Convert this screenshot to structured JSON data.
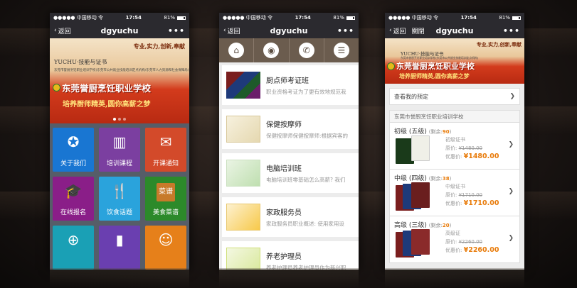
{
  "status_bar": {
    "carrier": "●●●●● 中国移动 令",
    "time": "17:54",
    "battery": "81%"
  },
  "phone1": {
    "nav": {
      "back": "返回",
      "title": "dgyuchu",
      "more": "•••"
    },
    "banner": {
      "slogan": "专业,实力,创新,奉献",
      "brand": "YUCHU·技能与证书",
      "brand_sub": "东莞市誉厨烹饪职业培训学校(东莞市公共就业技能培训定点机构/东莞市人力资源和社会保障局)",
      "school": "东莞誉厨烹饪职业学校",
      "tagline": "培养厨师精英,圆你高薪之梦"
    },
    "tiles": [
      {
        "label": "关于我们",
        "icon": "emblem-icon",
        "glyph": "✪"
      },
      {
        "label": "培训课程",
        "icon": "books-icon",
        "glyph": "▥"
      },
      {
        "label": "开课通知",
        "icon": "scroll-icon",
        "glyph": "✉"
      },
      {
        "label": "在线报名",
        "icon": "graduation-cap-icon",
        "glyph": "🎓"
      },
      {
        "label": "饮食话题",
        "icon": "utensils-icon",
        "glyph": "🍴"
      },
      {
        "label": "美食菜谱",
        "icon": "recipe-book-icon",
        "glyph": "菜谱"
      },
      {
        "label": "",
        "icon": "plus-icon",
        "glyph": "⊕"
      },
      {
        "label": "",
        "icon": "book-icon",
        "glyph": "▮"
      },
      {
        "label": "",
        "icon": "group-icon",
        "glyph": "☺"
      }
    ]
  },
  "phone2": {
    "nav": {
      "back": "返回",
      "title": "dgyuchu",
      "more": "•••"
    },
    "iconbar": [
      {
        "icon": "home-icon",
        "glyph": "⌂"
      },
      {
        "icon": "location-pin-icon",
        "glyph": "◉"
      },
      {
        "icon": "phone-icon",
        "glyph": "✆"
      },
      {
        "icon": "list-icon",
        "glyph": "☰"
      }
    ],
    "items": [
      {
        "title": "厨点师考证班",
        "desc": "职业资格考证为了更有效地规范我",
        "thumb": "th-books"
      },
      {
        "title": "保健按摩师",
        "desc": "保健按摩师保健按摩师:根据宾客的",
        "thumb": "th-massage"
      },
      {
        "title": "电脑培训班",
        "desc": "电脑培训班零基础怎么高薪? 我们",
        "thumb": "th-computer"
      },
      {
        "title": "家政服务员",
        "desc": "家政服务员职业概述: 使用家用设",
        "thumb": "th-family"
      },
      {
        "title": "养老护理员",
        "desc": "养老护理员养老护理员作为新兴职",
        "thumb": "th-elder"
      }
    ]
  },
  "phone3": {
    "nav": {
      "back": "返回",
      "close": "關閉",
      "title": "dgyuchu",
      "more": "•••"
    },
    "banner": {
      "slogan": "专业,实力,创新,奉献",
      "brand": "YUCHU·技能与证书",
      "brand_sub": "东莞市誉厨烹饪职业培训学校(东莞市公共就业技能培训定点机构)",
      "school": "东莞誉厨烹饪职业学校",
      "tagline": "培养厨师精英,圆你高薪之梦"
    },
    "reserve": "查看我的预定",
    "section": "东莞市誉厨烹饪职业培训学校",
    "courses": [
      {
        "level": "初级 (五级)",
        "remaining_label": "(剩余:",
        "remaining": "90",
        "cert": "初级证书",
        "orig": "¥1480.00",
        "price_label": "优惠价:",
        "price": "¥1480.00"
      },
      {
        "level": "中级 (四级)",
        "remaining_label": "(剩余:",
        "remaining": "38",
        "cert": "中级证书",
        "orig": "¥1710.00",
        "price_label": "优惠价:",
        "price": "¥1710.00"
      },
      {
        "level": "高级 (三级)",
        "remaining_label": "(剩余:",
        "remaining": "20",
        "cert": "高级证",
        "orig": "¥2260.00",
        "price_label": "优惠价:",
        "price": "¥2260.00"
      }
    ]
  }
}
